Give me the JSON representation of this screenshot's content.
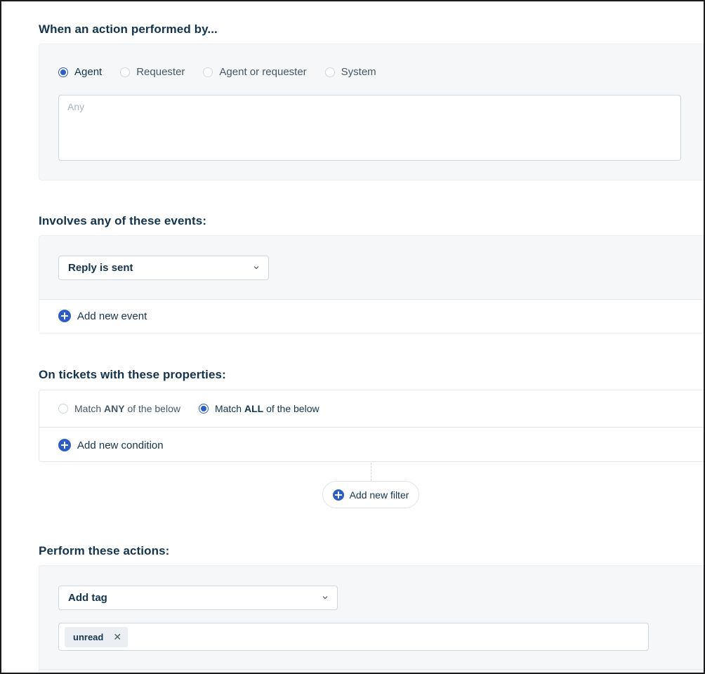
{
  "performed_by": {
    "title": "When an action performed by...",
    "options": [
      {
        "label": "Agent",
        "checked": true
      },
      {
        "label": "Requester",
        "checked": false
      },
      {
        "label": "Agent or requester",
        "checked": false
      },
      {
        "label": "System",
        "checked": false
      }
    ],
    "agents_placeholder": "Any"
  },
  "events": {
    "title": "Involves any of these events:",
    "selected_event": "Reply is sent",
    "add_label": "Add new event"
  },
  "properties": {
    "title": "On tickets with these properties:",
    "match_any": {
      "pre": "Match ",
      "bold": "ANY",
      "post": " of the below",
      "checked": false
    },
    "match_all": {
      "pre": "Match ",
      "bold": "ALL",
      "post": " of the below",
      "checked": true
    },
    "add_condition_label": "Add new condition",
    "add_filter_label": "Add new filter"
  },
  "actions": {
    "title": "Perform these actions:",
    "selected_action": "Add tag",
    "tags": [
      "unread"
    ],
    "remove_symbol": "✕"
  },
  "colors": {
    "accent": "#2c5cc5",
    "text": "#12344d",
    "panel_bg": "#f5f7f9"
  }
}
